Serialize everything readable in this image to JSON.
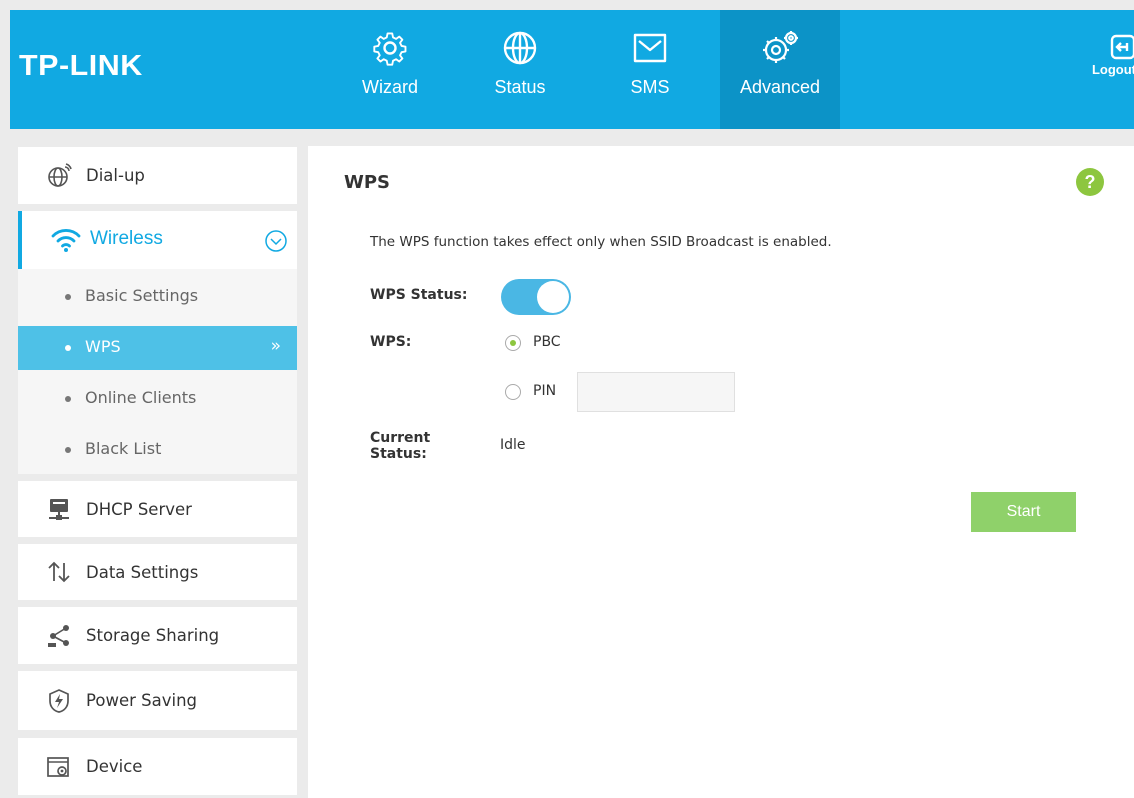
{
  "brand": {
    "logo": "TP-LINK"
  },
  "nav": {
    "items": [
      {
        "label": "Wizard",
        "icon": "gear-icon"
      },
      {
        "label": "Status",
        "icon": "globe-icon"
      },
      {
        "label": "SMS",
        "icon": "envelope-icon"
      },
      {
        "label": "Advanced",
        "icon": "gears-icon",
        "active": true
      }
    ],
    "logout": "Logout"
  },
  "sidebar": {
    "dialup": "Dial-up",
    "wireless": {
      "label": "Wireless",
      "items": [
        {
          "label": "Basic Settings"
        },
        {
          "label": "WPS",
          "active": true,
          "marker": "»"
        },
        {
          "label": "Online Clients"
        },
        {
          "label": "Black List"
        }
      ]
    },
    "dhcp": "DHCP Server",
    "data": "Data Settings",
    "storage": "Storage Sharing",
    "power": "Power Saving",
    "device": "Device"
  },
  "main": {
    "title": "WPS",
    "help": "?",
    "note": "The WPS function takes effect only when SSID Broadcast is enabled.",
    "wps_status_label": "WPS Status:",
    "wps_status_on": true,
    "wps_label": "WPS:",
    "options": {
      "pbc": "PBC",
      "pin": "PIN",
      "selected": "PBC"
    },
    "pin_value": "",
    "current_status_label_1": "Current",
    "current_status_label_2": "Status:",
    "current_status_value": "Idle",
    "start_button": "Start"
  },
  "colors": {
    "header": "#11a9e2",
    "header_active": "#0c93c7",
    "accent_green": "#8dc63f",
    "start_button": "#8fd16a",
    "sub_active": "#4ec1e7"
  }
}
